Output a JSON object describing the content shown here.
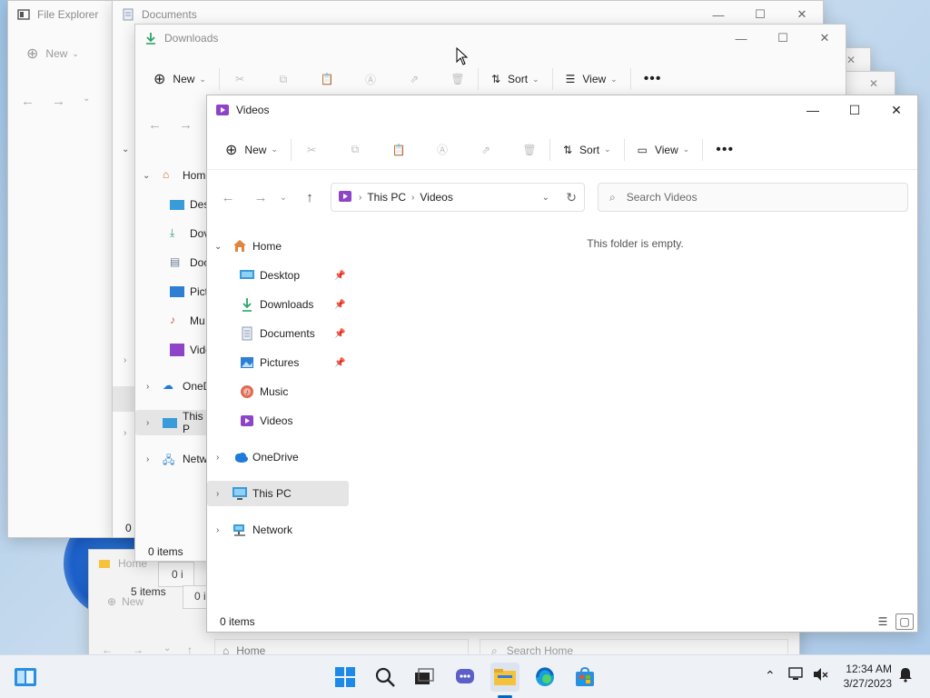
{
  "windows": {
    "file_explorer": {
      "title": "File Explorer",
      "new_label": "New"
    },
    "documents": {
      "title": "Documents",
      "status": "0 i"
    },
    "downloads": {
      "title": "Downloads",
      "cmd": {
        "new": "New",
        "sort": "Sort",
        "view": "View"
      },
      "nav": [
        "Home",
        "Des",
        "Dov",
        "Doc",
        "Pict",
        "Mu",
        "Vide",
        "OneD",
        "This P",
        "Netw"
      ],
      "status": "0 items"
    },
    "home_back": {
      "title": "Home",
      "status": "5 items",
      "new_label": "New",
      "addr": "Home",
      "search": "Search Home",
      "status2": "0 i"
    },
    "videos": {
      "title": "Videos",
      "cmd": {
        "new": "New",
        "sort": "Sort",
        "view": "View"
      },
      "address": {
        "root": "This PC",
        "current": "Videos"
      },
      "search_placeholder": "Search Videos",
      "nav": {
        "home": "Home",
        "quick": [
          {
            "label": "Desktop",
            "icon": "desktop-icon",
            "pinned": true
          },
          {
            "label": "Downloads",
            "icon": "download-icon",
            "pinned": true
          },
          {
            "label": "Documents",
            "icon": "document-icon",
            "pinned": true
          },
          {
            "label": "Pictures",
            "icon": "pictures-icon",
            "pinned": true
          },
          {
            "label": "Music",
            "icon": "music-icon",
            "pinned": false
          },
          {
            "label": "Videos",
            "icon": "videos-icon",
            "pinned": false
          }
        ],
        "onedrive": "OneDrive",
        "this_pc": "This PC",
        "network": "Network"
      },
      "empty_text": "This folder is empty.",
      "status": "0 items"
    }
  },
  "taskbar": {
    "time": "12:34 AM",
    "date": "3/27/2023",
    "apps": [
      "start-icon",
      "search-icon",
      "task-view-icon",
      "chat-icon",
      "file-explorer-icon",
      "edge-icon",
      "store-icon"
    ]
  },
  "colors": {
    "accent": "#0067c0",
    "folder": "#f5c33b",
    "videos_purple": "#8e44c9"
  }
}
